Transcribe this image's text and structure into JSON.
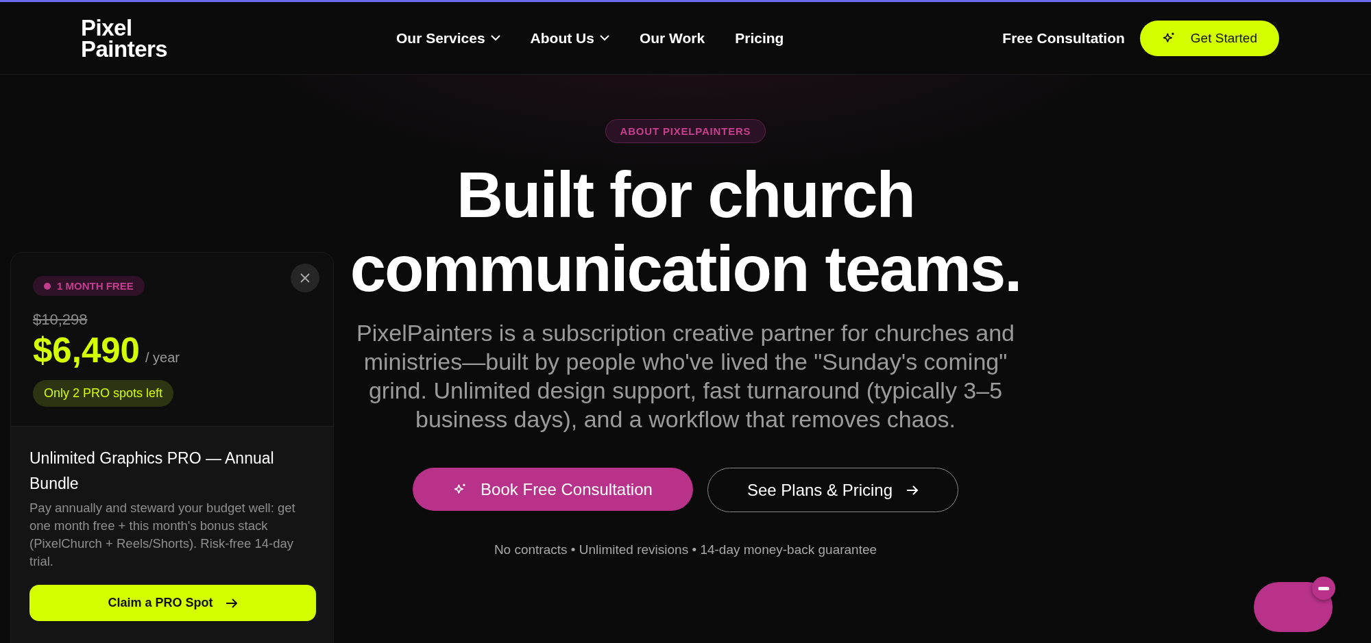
{
  "header": {
    "logo": [
      "Pixel",
      "Painters"
    ],
    "nav": [
      {
        "label": "Our Services",
        "dropdown": true
      },
      {
        "label": "About Us",
        "dropdown": true
      },
      {
        "label": "Our Work",
        "dropdown": false
      },
      {
        "label": "Pricing",
        "dropdown": false
      }
    ],
    "consultation_link": "Free Consultation",
    "cta": "Get Started"
  },
  "hero": {
    "eyebrow": "ABOUT PIXELPAINTERS",
    "title": [
      "Built for church",
      "communication teams."
    ],
    "description": "PixelPainters is a subscription creative partner for churches and ministries—built by people who've lived the \"Sunday's coming\" grind. Unlimited design support, fast turnaround (typically 3–5 business days), and a workflow that removes chaos.",
    "primary_button": "Book Free Consultation",
    "secondary_button": "See Plans & Pricing",
    "note": "No contracts • Unlimited revisions • 14-day money-back guarantee"
  },
  "promo": {
    "badge": "1 MONTH FREE",
    "old_price": "$10,298",
    "price": "$6,490",
    "period": "/ year",
    "scarcity": "Only 2 PRO spots left",
    "title": "Unlimited Graphics PRO — Annual Bundle",
    "description": "Pay annually and steward your budget well: get one month free + this month's bonus stack (PixelChurch + Reels/Shorts). Risk-free 14-day trial.",
    "button": "Claim a PRO Spot"
  }
}
